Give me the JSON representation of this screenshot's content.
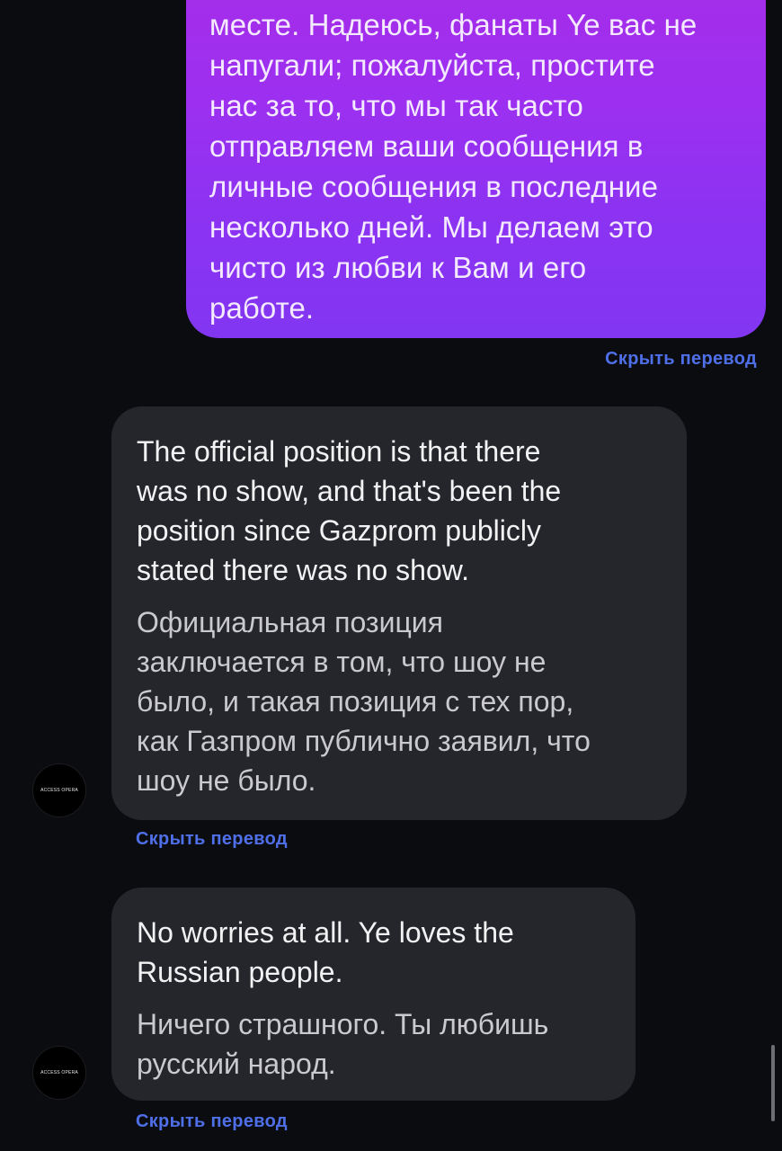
{
  "messages": {
    "outgoing": {
      "text": "месте. Надеюсь, фанаты Ye вас не\nнапугали; пожалуйста, простите\nнас за то, что мы так часто\nотправляем ваши сообщения в\nличные сообщения в последние\nнесколько дней. Мы делаем это\nчисто из любви к Вам и его\nработе.",
      "hide_translation": "Скрыть перевод"
    },
    "incoming": [
      {
        "avatar_label": "ACCESS OPERA",
        "original": "The official position is that there\nwas no show, and that's been the\nposition since Gazprom publicly\nstated there was no show.",
        "translation": "Официальная позиция\nзаключается в том, что шоу не\nбыло, и такая позиция с тех пор,\nкак Газпром публично заявил, что\nшоу не было.",
        "hide_translation": "Скрыть перевод"
      },
      {
        "avatar_label": "ACCESS OPERA",
        "original": "No worries at all. Ye loves the\nRussian people.",
        "translation": "Ничего страшного. Ты любишь\nрусский народ.",
        "hide_translation": "Скрыть перевод"
      }
    ]
  },
  "colors": {
    "background": "#0b0c10",
    "outgoing_gradient_top": "#a62ee8",
    "outgoing_gradient_bottom": "#8236f2",
    "incoming_bubble": "#25262b",
    "link": "#4f6fe8"
  }
}
